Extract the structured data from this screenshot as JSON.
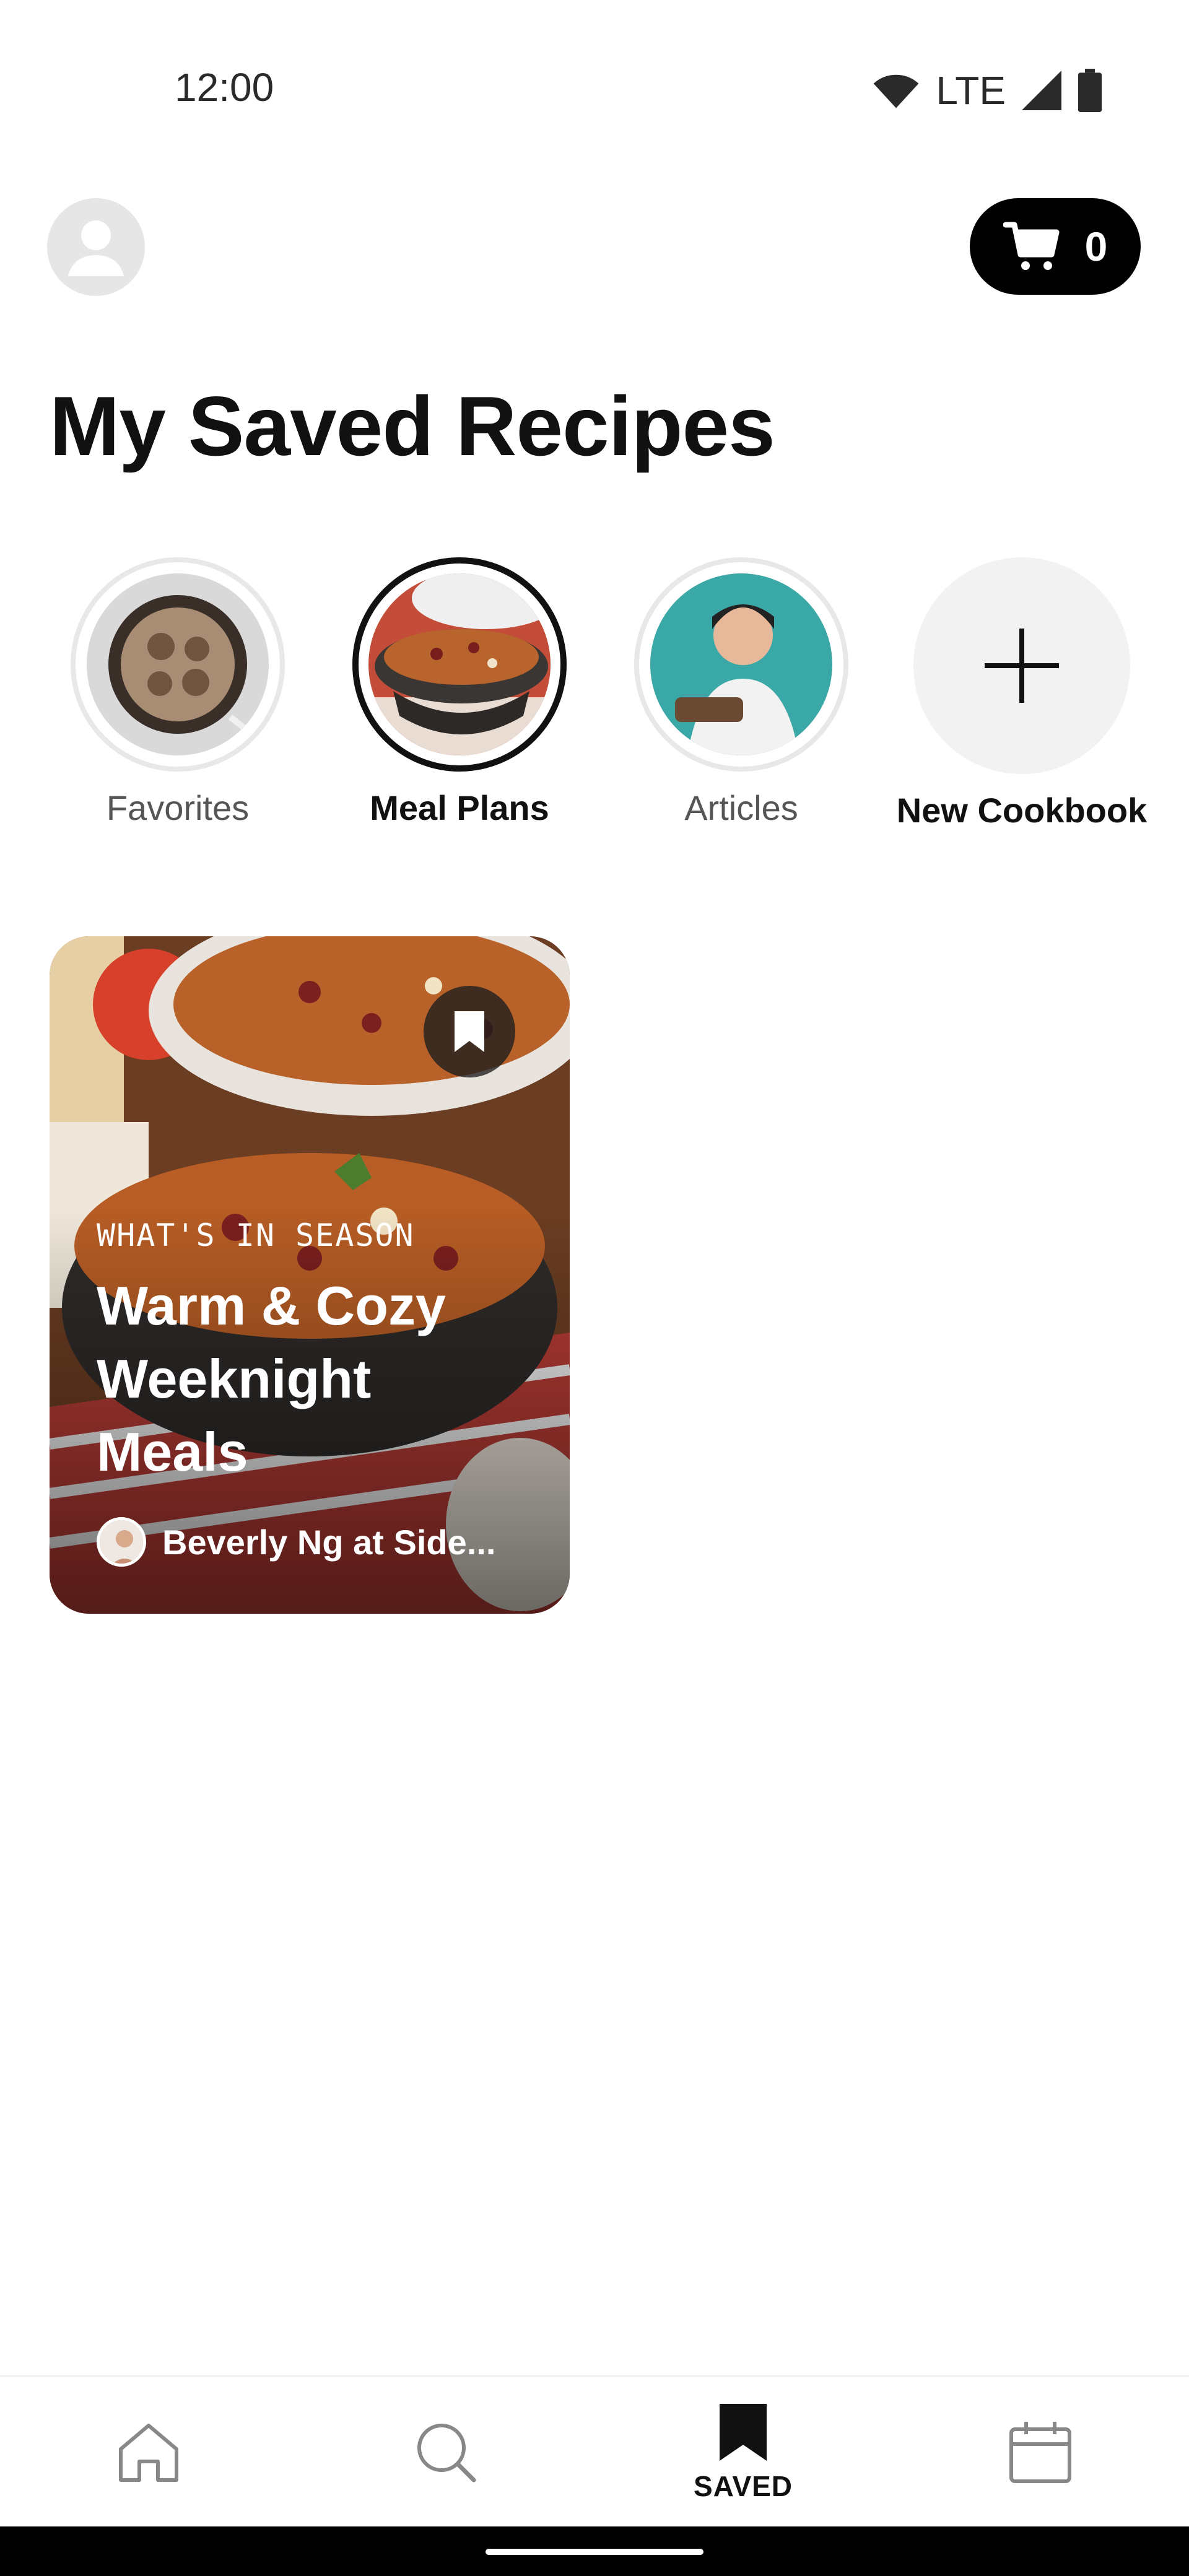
{
  "status_bar": {
    "time": "12:00",
    "network": "LTE"
  },
  "header": {
    "cart_count": "0"
  },
  "page": {
    "title": "My Saved Recipes"
  },
  "cookbooks": [
    {
      "label": "Favorites",
      "selected": false
    },
    {
      "label": "Meal Plans",
      "selected": true
    },
    {
      "label": "Articles",
      "selected": false
    },
    {
      "label": "New Cookbook",
      "selected": false
    }
  ],
  "cards": [
    {
      "kicker": "WHAT'S IN SEASON",
      "title": "Warm & Cozy Weeknight Meals",
      "author": "Beverly Ng at Side..."
    }
  ],
  "bottom_nav": [
    {
      "icon": "home-icon",
      "label": ""
    },
    {
      "icon": "search-icon",
      "label": ""
    },
    {
      "icon": "bookmark-icon",
      "label": "SAVED",
      "active": true
    },
    {
      "icon": "calendar-icon",
      "label": ""
    }
  ],
  "colors": {
    "accent": "#000000",
    "background": "#ffffff",
    "muted_label": "#555555"
  }
}
